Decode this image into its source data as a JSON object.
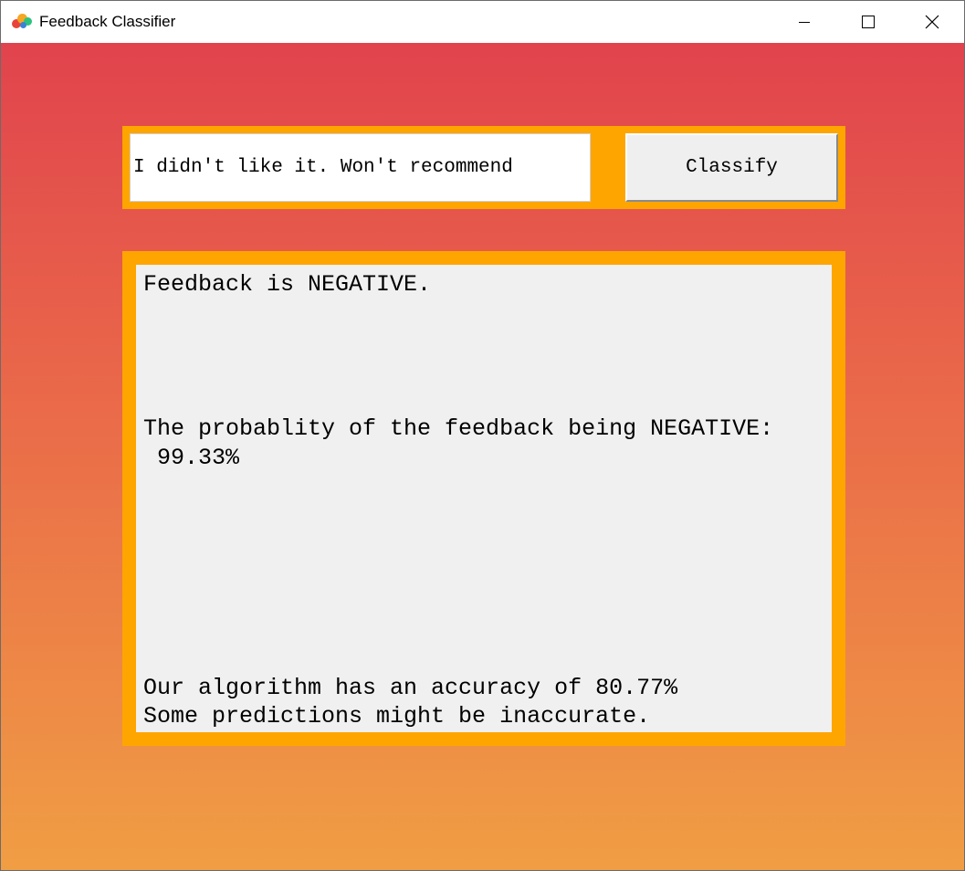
{
  "window": {
    "title": "Feedback Classifier",
    "icon": "colored-dots-app-icon",
    "controls": [
      "minimize-icon",
      "maximize-icon",
      "close-icon"
    ]
  },
  "input": {
    "value": "I didn't like it. Won't recommend"
  },
  "classify_button": {
    "label": "Classify"
  },
  "result": {
    "verdict": "Feedback is NEGATIVE.",
    "probability_label": "The probablity of the feedback being NEGATIVE:",
    "probability_value": " 99.33%",
    "accuracy_note": "Our algorithm has an accuracy of 80.77%",
    "disclaimer": "Some predictions might be inaccurate."
  },
  "colors": {
    "frame": "#ffa500",
    "gradient_top": "#e1434d",
    "gradient_bottom": "#f09e44",
    "panel": "#f0f0f0"
  }
}
